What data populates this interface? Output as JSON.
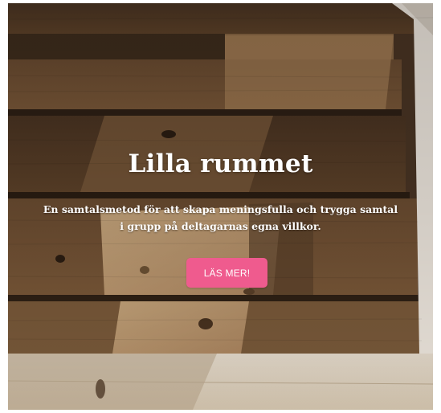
{
  "hero": {
    "title": "Lilla rummet",
    "subtitle": "En samtalsmetod för att skapa meningsfulla och trygga samtal i grupp på deltagarnas egna villkor.",
    "cta_label": "LÄS MER!"
  },
  "colors": {
    "cta_background": "#ef5b8e",
    "text": "#ffffff",
    "wood_dark": "#3d2b1c",
    "wood_light": "#c9a57a"
  }
}
